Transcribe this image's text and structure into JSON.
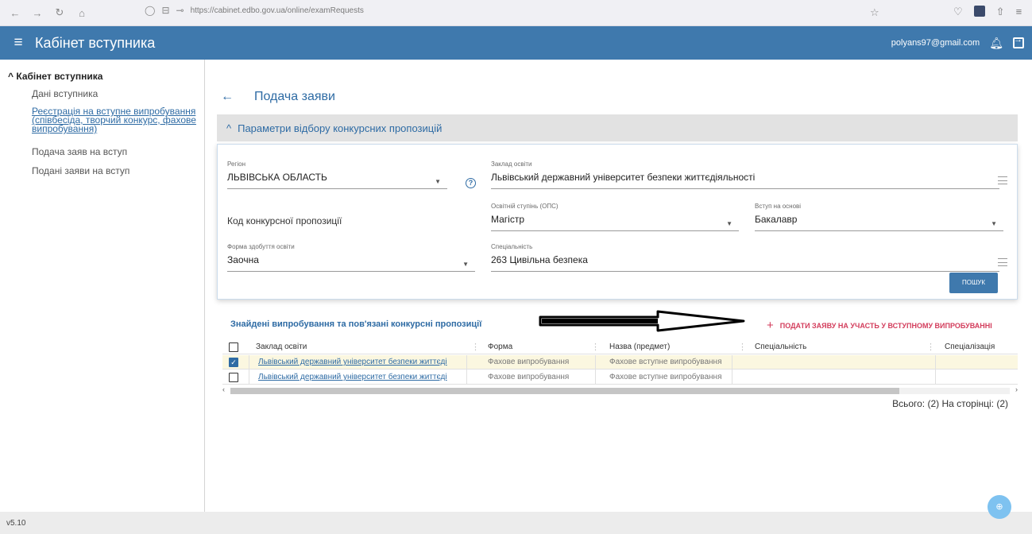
{
  "browser": {
    "url": "https://cabinet.edbo.gov.ua/online/examRequests",
    "icons": [
      "back-arrow",
      "forward-arrow",
      "reload",
      "home",
      "shield",
      "lock",
      "key",
      "star",
      "pocket",
      "extension",
      "share",
      "hamburger"
    ]
  },
  "header": {
    "title": "Кабінет вступника",
    "user_email": "polyans97@gmail.com"
  },
  "sidebar": {
    "section": "Кабінет вступника",
    "items": [
      {
        "label": "Дані вступника"
      },
      {
        "label": "Реєстрація на вступне випробування (співбесіда, творчий конкурс, фахове випробування)"
      },
      {
        "label": "Подача заяв на вступ"
      },
      {
        "label": "Подані заяви на вступ"
      }
    ]
  },
  "page": {
    "title": "Подача заяви",
    "filter_title": "Параметри відбору конкурсних пропозицій"
  },
  "form": {
    "region": {
      "label": "Регіон",
      "value": "ЛЬВІВСЬКА ОБЛАСТЬ"
    },
    "institution": {
      "label": "Заклад освіти",
      "value": "Львівський державний університет безпеки життєдіяльності"
    },
    "competitive_code_label": "Код конкурсної пропозиції",
    "degree": {
      "label": "Освітній ступінь (ОПС)",
      "value": "Магістр"
    },
    "based_on": {
      "label": "Вступ на основі",
      "value": "Бакалавр"
    },
    "study_form": {
      "label": "Форма здобуття освіти",
      "value": "Заочна"
    },
    "specialty": {
      "label": "Спеціальність",
      "value": "263 Цивільна безпека"
    },
    "search_button": "ПОШУК"
  },
  "results": {
    "title": "Знайдені випробування та пов'язані конкурсні пропозиції",
    "apply_label": "ПОДАТИ ЗАЯВУ НА УЧАСТЬ У ВСТУПНОМУ ВИПРОБУВАННІ",
    "columns": [
      "Заклад освіти",
      "Форма",
      "Назва (предмет)",
      "Спеціальність",
      "Спеціалізація"
    ],
    "rows": [
      {
        "checked": true,
        "institution": "Львівський державний університет безпеки життєді",
        "form": "Фахове випробування",
        "name": "Фахове вступне випробування",
        "specialty": "",
        "specialization": ""
      },
      {
        "checked": false,
        "institution": "Львівський державний університет безпеки життєді",
        "form": "Фахове випробування",
        "name": "Фахове вступне випробування",
        "specialty": "",
        "specialization": ""
      }
    ],
    "total_text": "Всього: (2) На сторінці: (2)"
  },
  "footer": {
    "version": "v5.10"
  }
}
